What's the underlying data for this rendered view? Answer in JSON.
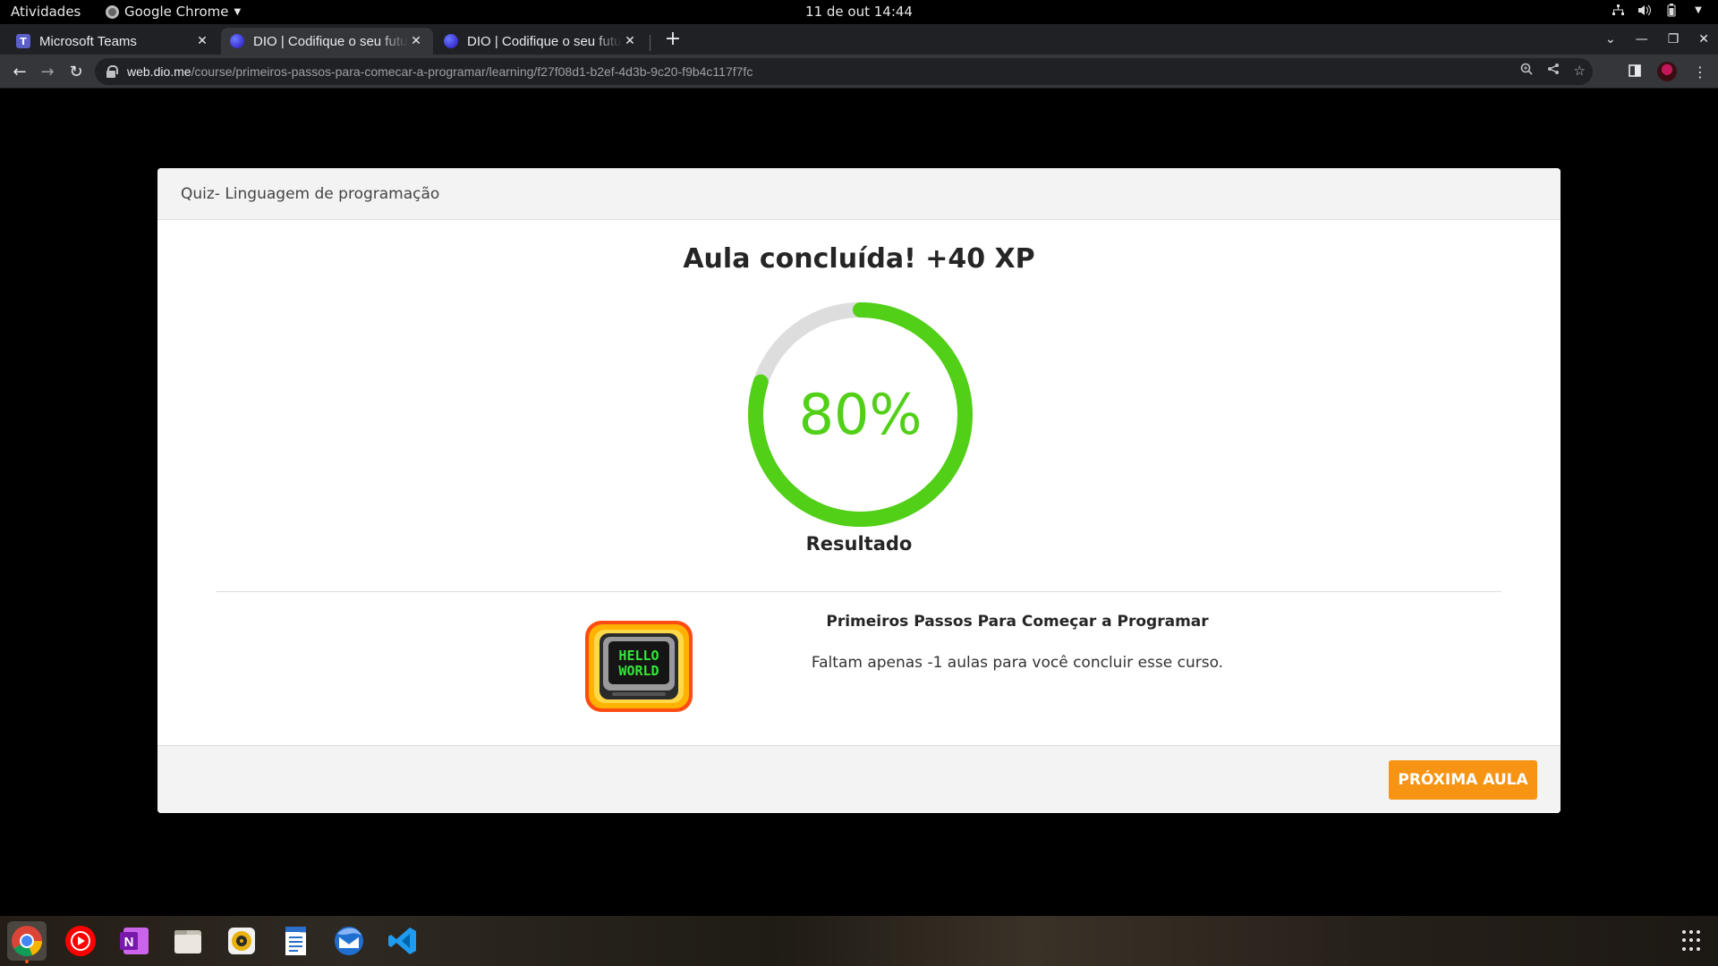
{
  "system_bar": {
    "activities": "Atividades",
    "app_name": "Google Chrome",
    "clock": "11 de out  14:44"
  },
  "browser": {
    "tabs": [
      {
        "title": "Microsoft Teams",
        "favicon": "teams-icon",
        "active": false
      },
      {
        "title": "DIO | Codifique o seu futuro",
        "favicon": "dio-icon",
        "active": true
      },
      {
        "title": "DIO | Codifique o seu futuro",
        "favicon": "dio-icon",
        "active": false
      }
    ],
    "url_host": "web.dio.me",
    "url_path": "/course/primeiros-passos-para-comecar-a-programar/learning/f27f08d1-b2ef-4d3b-9c20-f9b4c117f7fc"
  },
  "modal": {
    "header_title": "Quiz- Linguagem de programação",
    "result_title": "Aula concluída! +40 XP",
    "progress_text": "80%",
    "progress_fraction": 0.8,
    "result_label": "Resultado",
    "course_title": "Primeiros Passos Para Começar a Programar",
    "course_subtitle": "Faltam apenas -1 aulas para você concluir esse curso.",
    "badge_text_line1": "HELLO",
    "badge_text_line2": "WORLD",
    "next_button": "PRÓXIMA AULA"
  },
  "colors": {
    "progress": "#51d017",
    "progress_track": "#dddddd",
    "accent_button": "#f79413"
  },
  "dock": {
    "items": [
      "chrome-icon",
      "youtube-music-icon",
      "onenote-icon",
      "files-icon",
      "rhythmbox-icon",
      "text-editor-icon",
      "thunderbird-icon",
      "vscode-icon"
    ]
  }
}
